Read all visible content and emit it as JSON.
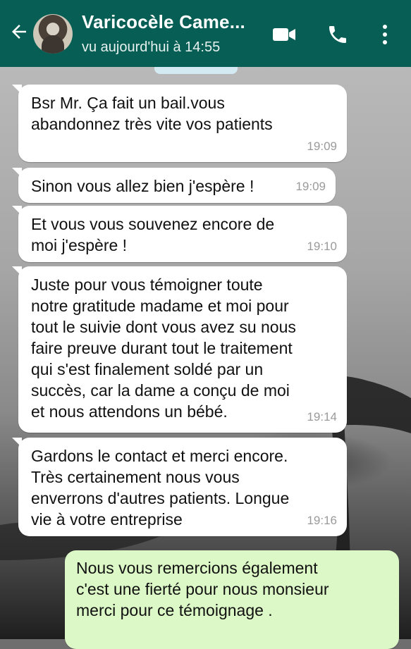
{
  "header": {
    "contact_name": "Varicocèle Came...",
    "last_seen": "vu aujourd'hui à 14:55",
    "icons": [
      "back-arrow-icon",
      "avatar",
      "video-call-icon",
      "phone-call-icon",
      "more-vert-icon"
    ]
  },
  "colors": {
    "header": "#075e54",
    "incoming_bubble": "#ffffff",
    "outgoing_bubble": "#dcf8c6",
    "timestamp": "#9a9a9a"
  },
  "messages": [
    {
      "direction": "in",
      "text": "Bsr Mr. Ça fait un bail.vous\nabandonnez très vite vos patients",
      "time": "19:09"
    },
    {
      "direction": "in",
      "text": "Sinon vous allez bien j'espère !",
      "time": "19:09"
    },
    {
      "direction": "in",
      "text": "Et vous vous souvenez encore de\nmoi j'espère !",
      "time": "19:10"
    },
    {
      "direction": "in",
      "text": "Juste pour vous témoigner toute\nnotre gratitude madame et moi pour\ntout le suivie dont vous avez su nous\nfaire preuve durant tout le traitement\nqui s'est finalement soldé par un\nsuccès, car la dame a conçu de moi\net nous attendons un bébé.",
      "time": "19:14"
    },
    {
      "direction": "in",
      "text": "Gardons le contact et merci encore.\nTrès certainement nous vous\nenverrons d'autres patients. Longue\nvie à votre entreprise",
      "time": "19:16"
    },
    {
      "direction": "out",
      "text": "Nous vous remercions également\nc'est une fierté pour nous monsieur\nmerci pour ce témoignage .",
      "time": ""
    }
  ]
}
